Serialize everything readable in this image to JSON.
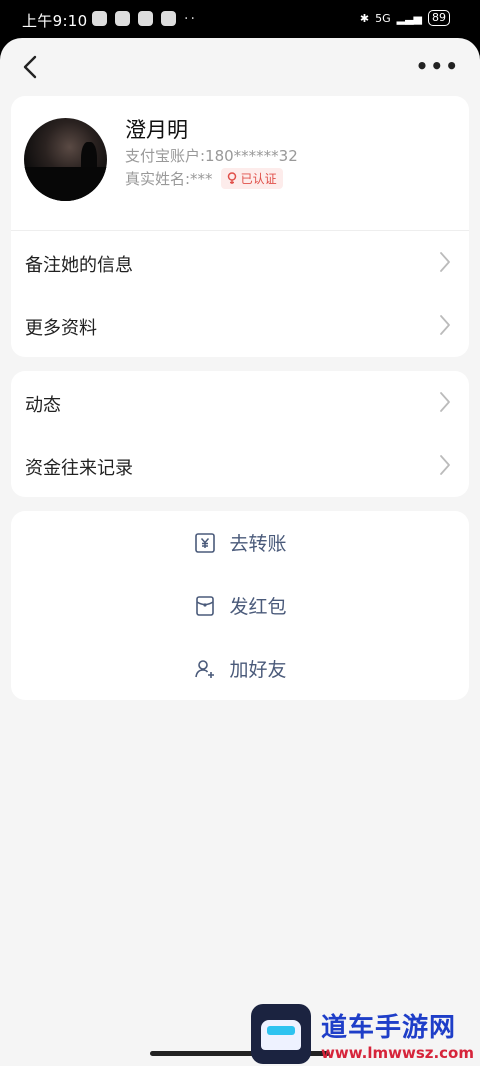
{
  "status_bar": {
    "time": "上午9:10",
    "network": "5G",
    "battery": "89"
  },
  "nav": {
    "back_icon": "chevron-left-icon",
    "more_icon": "more-horizontal-icon"
  },
  "profile": {
    "name": "澄月明",
    "account": "支付宝账户:180******32",
    "real_name": "真实姓名:***",
    "verified_label": "已认证"
  },
  "info_rows": [
    {
      "label": "备注她的信息"
    },
    {
      "label": "更多资料"
    }
  ],
  "activity_rows": [
    {
      "label": "动态"
    },
    {
      "label": "资金往来记录"
    }
  ],
  "actions": [
    {
      "label": "去转账",
      "icon": "yuan-transfer-icon"
    },
    {
      "label": "发红包",
      "icon": "red-envelope-icon"
    },
    {
      "label": "加好友",
      "icon": "add-friend-icon"
    }
  ],
  "watermark": {
    "title": "道车手游网",
    "url": "www.lmwwsz.com"
  },
  "colors": {
    "accent_action": "#4a5a7a",
    "verified": "#e0504a",
    "background": "#f5f5f5"
  }
}
